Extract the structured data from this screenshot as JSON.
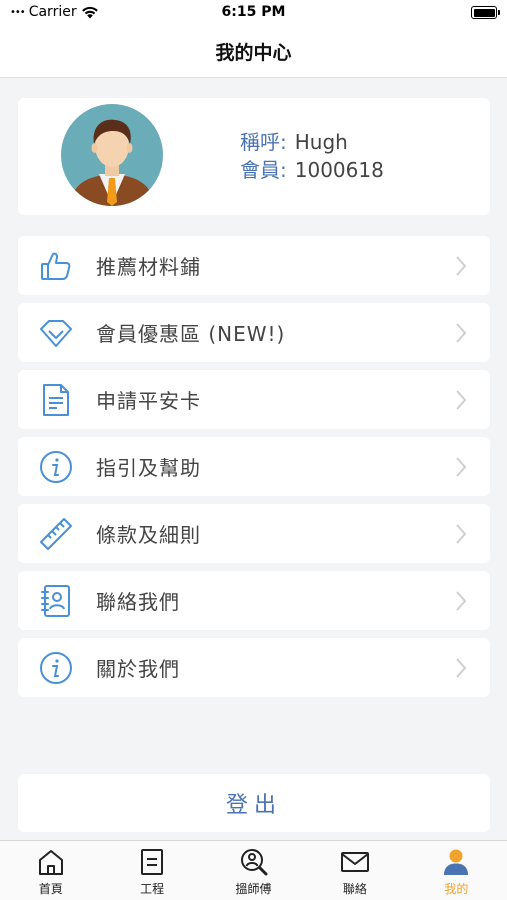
{
  "status_bar": {
    "carrier": "Carrier",
    "time": "6:15 PM"
  },
  "nav": {
    "title": "我的中心"
  },
  "profile": {
    "name_label": "稱呼:",
    "name_value": "Hugh",
    "member_label": "會員:",
    "member_value": "1000618"
  },
  "menu": [
    {
      "label": "推薦材料鋪",
      "icon": "thumbs-up-icon"
    },
    {
      "label": "會員優惠區 (NEW!)",
      "icon": "diamond-icon"
    },
    {
      "label": "申請平安卡",
      "icon": "document-icon"
    },
    {
      "label": "指引及幫助",
      "icon": "info-icon"
    },
    {
      "label": "條款及細則",
      "icon": "ruler-icon"
    },
    {
      "label": "聯絡我們",
      "icon": "contact-book-icon"
    },
    {
      "label": "關於我們",
      "icon": "info-icon"
    }
  ],
  "logout_label": "登出",
  "tabs": [
    {
      "label": "首頁",
      "icon": "home-icon"
    },
    {
      "label": "工程",
      "icon": "list-icon"
    },
    {
      "label": "搵師傅",
      "icon": "search-person-icon"
    },
    {
      "label": "聯絡",
      "icon": "mail-icon"
    },
    {
      "label": "我的",
      "icon": "person-icon",
      "active": true
    }
  ],
  "colors": {
    "accent": "#4a74b1",
    "icon_blue": "#4a90d9",
    "tab_active": "#f0a22c"
  }
}
